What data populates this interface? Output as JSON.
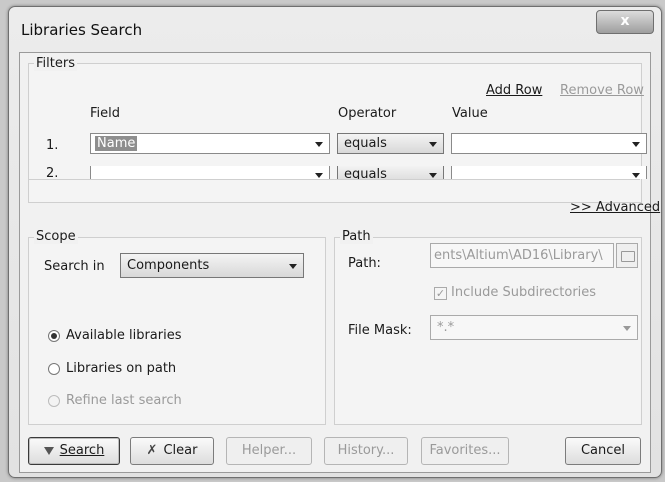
{
  "window": {
    "title": "Libraries Search",
    "close_glyph": "x"
  },
  "filters": {
    "label": "Filters",
    "add_row": "Add Row",
    "remove_row": "Remove Row",
    "columns": {
      "field": "Field",
      "operator": "Operator",
      "value": "Value"
    },
    "rows": [
      {
        "index": "1.",
        "field": "Name",
        "operator": "equals",
        "value": ""
      },
      {
        "index": "2.",
        "field": "",
        "operator": "equals",
        "value": ""
      }
    ],
    "advanced": ">> Advanced"
  },
  "scope": {
    "label": "Scope",
    "search_in_label": "Search in",
    "search_in_value": "Components",
    "options": [
      {
        "label": "Available libraries",
        "selected": true,
        "enabled": true
      },
      {
        "label": "Libraries on path",
        "selected": false,
        "enabled": true
      },
      {
        "label": "Refine last search",
        "selected": false,
        "enabled": false
      }
    ]
  },
  "path": {
    "label": "Path",
    "path_label": "Path:",
    "path_value": "ents\\Altium\\AD16\\Library\\",
    "include_subdirs": "Include Subdirectories",
    "include_subdirs_checked": true,
    "file_mask_label": "File Mask:",
    "file_mask_value": "*.*"
  },
  "buttons": {
    "search": "Search",
    "clear": "Clear",
    "helper": "Helper...",
    "history": "History...",
    "favorites": "Favorites...",
    "cancel": "Cancel"
  }
}
